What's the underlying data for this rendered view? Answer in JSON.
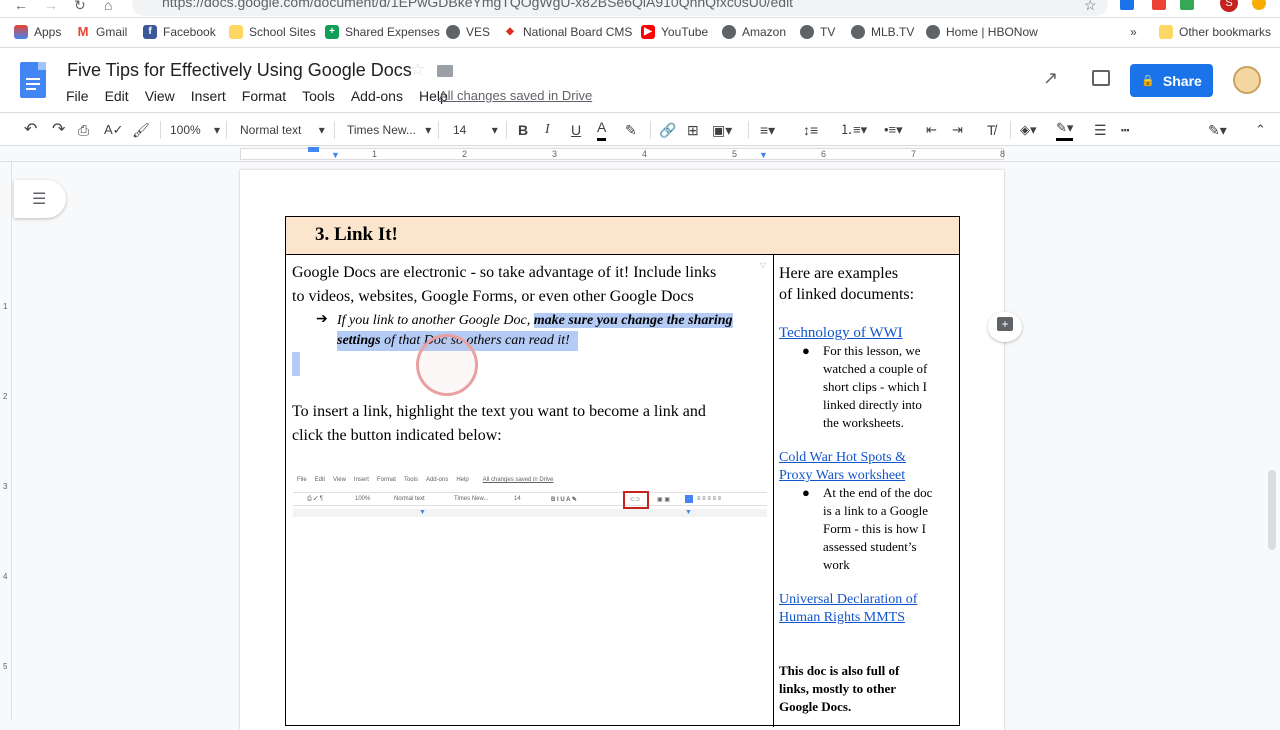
{
  "browser": {
    "url": "https://docs.google.com/document/d/1EPwGDBkeYmgTQOgWgU-x82BSe6QiA910QhhQfxc0sU0/edit",
    "bookmarks": [
      "Apps",
      "Gmail",
      "Facebook",
      "School Sites",
      "Shared Expenses",
      "VES",
      "National Board CMS",
      "YouTube",
      "Amazon",
      "TV",
      "MLB.TV",
      "Home | HBONow"
    ],
    "overflow": "»",
    "other_bookmarks": "Other bookmarks",
    "profile_initial": "S"
  },
  "doc": {
    "title": "Five Tips for Effectively Using Google Docs",
    "menus": [
      "File",
      "Edit",
      "View",
      "Insert",
      "Format",
      "Tools",
      "Add-ons",
      "Help"
    ],
    "saved_status": "All changes saved in Drive",
    "share_label": "Share"
  },
  "toolbar": {
    "zoom": "100%",
    "style": "Normal text",
    "font": "Times New...",
    "size": "14"
  },
  "ruler": {
    "marks": [
      "1",
      "2",
      "3",
      "4",
      "5",
      "6",
      "7",
      "8"
    ],
    "vmarks": [
      "1",
      "2",
      "3",
      "4",
      "5"
    ]
  },
  "content": {
    "heading": "3.  Link It!",
    "left": {
      "para1_line1": "Google Docs are electronic - so take advantage of it!  Include links",
      "para1_line2": "to videos, websites, Google Forms, or even other Google Docs",
      "arrow": "➔",
      "bullet_line1_normal": "If you link to another Google Doc, ",
      "bullet_line1_bold": "make sure you change the sharing",
      "bullet_line2_bold": "settings",
      "bullet_line2_normal": " of that Doc so others can read it!",
      "para2_line1": "To insert a link, highlight the text you want to become a link and",
      "para2_line2": "click the button indicated below:"
    },
    "mini": {
      "menus": [
        "File",
        "Edit",
        "View",
        "Insert",
        "Format",
        "Tools",
        "Add-ons",
        "Help"
      ],
      "saved": "All changes saved in Drive",
      "zoom": "100%",
      "style": "Normal text",
      "font": "Times New...",
      "size": "14"
    },
    "right": {
      "intro_line1": "Here are examples",
      "intro_line2": "of linked documents:",
      "link1": "Technology of WWI",
      "bullet1": [
        "For this lesson, we",
        "watched a couple of",
        "short clips - which I",
        "linked directly into",
        "the worksheets."
      ],
      "link2_line1": "Cold War Hot Spots &",
      "link2_line2": "Proxy Wars worksheet",
      "bullet2": [
        "At the end of the doc",
        "is a link to a Google",
        "Form - this is how I",
        "assessed student’s",
        "work"
      ],
      "link3_line1": "Universal Declaration of",
      "link3_line2": "Human Rights MMTS",
      "closing": [
        "This doc is also full of",
        "links, mostly to other",
        "Google Docs."
      ]
    }
  },
  "colors": {
    "accent": "#1a73e8",
    "header_fill": "#fbe5cd",
    "highlight": "#b4cbf5",
    "link": "#1155cc"
  }
}
